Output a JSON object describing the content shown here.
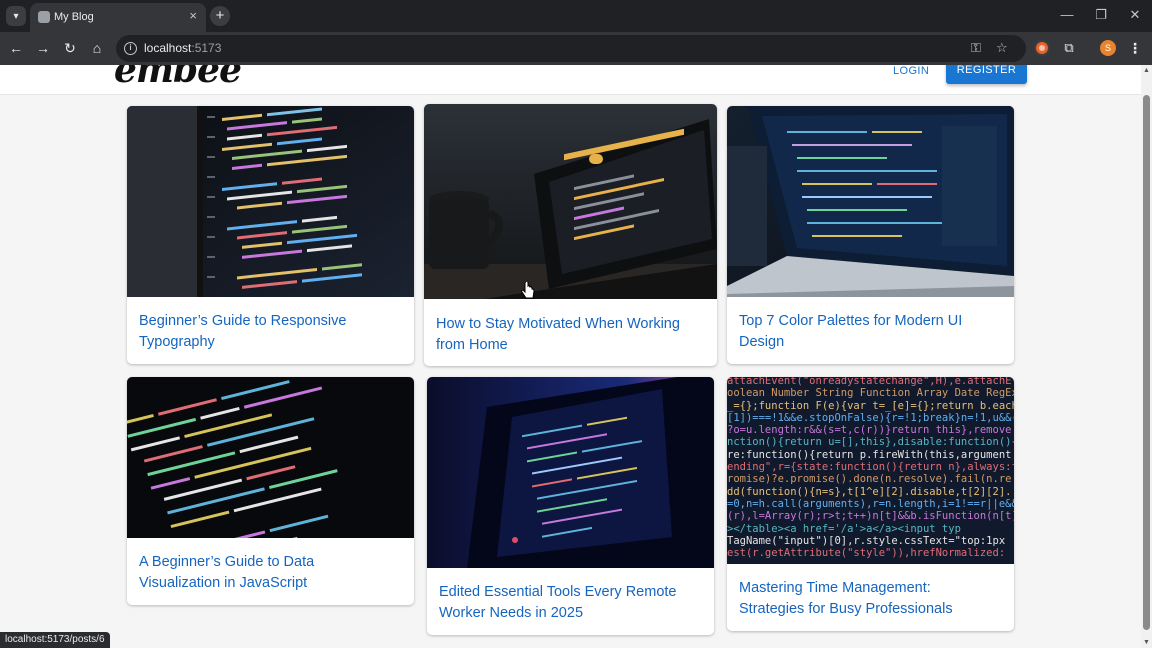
{
  "browser": {
    "tab_title": "My Blog",
    "tab_close": "×",
    "new_tab": "+",
    "url_host": "localhost",
    "url_port": ":5173",
    "status_url": "localhost:5173/posts/6",
    "icons": [
      "tab-menu-icon",
      "back-icon",
      "forward-icon",
      "reload-icon",
      "home-icon",
      "site-info-icon",
      "password-key-icon",
      "bookmark-star-icon",
      "extension-icon",
      "puzzle-extensions-icon",
      "profile-avatar",
      "more-menu-icon"
    ]
  },
  "header": {
    "logo": "embee",
    "login": "LOGIN",
    "register": "REGISTER",
    "accent": "#1976d2"
  },
  "posts": [
    {
      "title": "Beginner’s Guide to Responsive Typography"
    },
    {
      "title": "How to Stay Motivated When Working from Home"
    },
    {
      "title": "Top 7 Color Palettes for Modern UI Design"
    },
    {
      "title": "A Beginner’s Guide to Data Visualization in JavaScript"
    },
    {
      "title": "Edited Essential Tools Every Remote Worker Needs in 2025"
    },
    {
      "title": "Mastering Time Management: Strategies for Busy Professionals"
    }
  ],
  "code_snippet": [
    "attachEvent(\"onreadystatechange\",H),e.attachE",
    "oolean Number String Function Array Date RegEx",
    "_={};function F(e){var t=_[e]={};return b.each",
    "[1])===!1&&e.stopOnFalse){r=!1;break}n=!1,u&&(",
    "?o=u.length:r&&(s=t,c(r))}return this},remove:",
    "nction(){return u=[],this},disable:function(){",
    "re:function(){return p.fireWith(this,argument",
    "ending\",r={state:function(){return n},always:f",
    "romise)?e.promise().done(n.resolve).fail(n.re",
    "dd(function(){n=s},t[1^e][2].disable,t[2][2].",
    "=0,n=h.call(arguments),r=n.length,i=1!==r||e&&",
    "(r),l=Array(r);r>t;t++)n[t]&&b.isFunction(n[t]",
    "></table><a href='/a'>a</a><input typ",
    "TagName(\"input\")[0],r.style.cssText=\"top:1px",
    "est(r.getAttribute(\"style\")),hrefNormalized:"
  ]
}
